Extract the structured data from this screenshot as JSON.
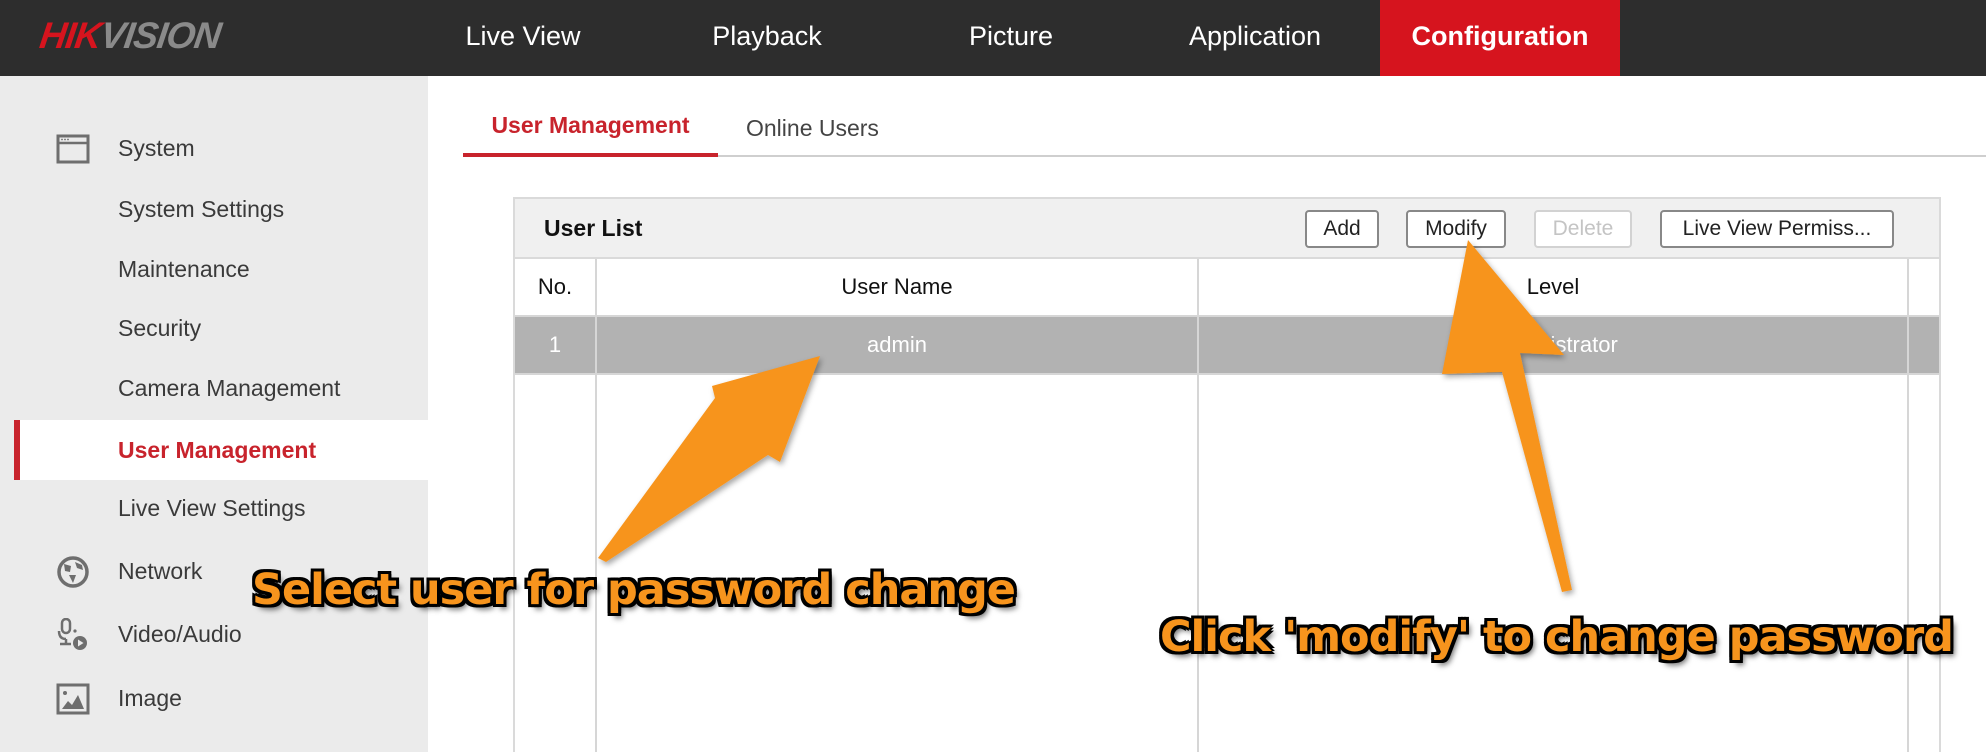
{
  "brand": {
    "logo_red": "HIK",
    "logo_gray": "VISION",
    "accent": "#d6141e"
  },
  "topnav": {
    "items": [
      {
        "label": "Live View"
      },
      {
        "label": "Playback"
      },
      {
        "label": "Picture"
      },
      {
        "label": "Application"
      },
      {
        "label": "Configuration",
        "active": true
      }
    ]
  },
  "sidebar": {
    "items": [
      {
        "label": "System",
        "icon": "window-icon",
        "type": "section"
      },
      {
        "label": "System Settings",
        "type": "sub"
      },
      {
        "label": "Maintenance",
        "type": "sub"
      },
      {
        "label": "Security",
        "type": "sub"
      },
      {
        "label": "Camera Management",
        "type": "sub"
      },
      {
        "label": "User Management",
        "type": "sub",
        "active": true
      },
      {
        "label": "Live View Settings",
        "type": "sub"
      },
      {
        "label": "Network",
        "icon": "globe-icon",
        "type": "section"
      },
      {
        "label": "Video/Audio",
        "icon": "mic-play-icon",
        "type": "section"
      },
      {
        "label": "Image",
        "icon": "image-icon",
        "type": "section"
      }
    ]
  },
  "tabs": [
    {
      "label": "User Management",
      "active": true
    },
    {
      "label": "Online Users",
      "active": false
    }
  ],
  "user_list": {
    "title": "User List",
    "buttons": {
      "add": "Add",
      "modify": "Modify",
      "delete": "Delete",
      "live_view_permission": "Live View Permiss..."
    },
    "columns": [
      "No.",
      "User Name",
      "Level"
    ],
    "rows": [
      {
        "no": "1",
        "user_name": "admin",
        "level": "Administrator",
        "level_visible": "inistrator",
        "selected": true
      }
    ]
  },
  "annotations": {
    "select_user": "Select user for password change",
    "click_modify": "Click 'modify' to change password",
    "color": "#f7941d"
  }
}
